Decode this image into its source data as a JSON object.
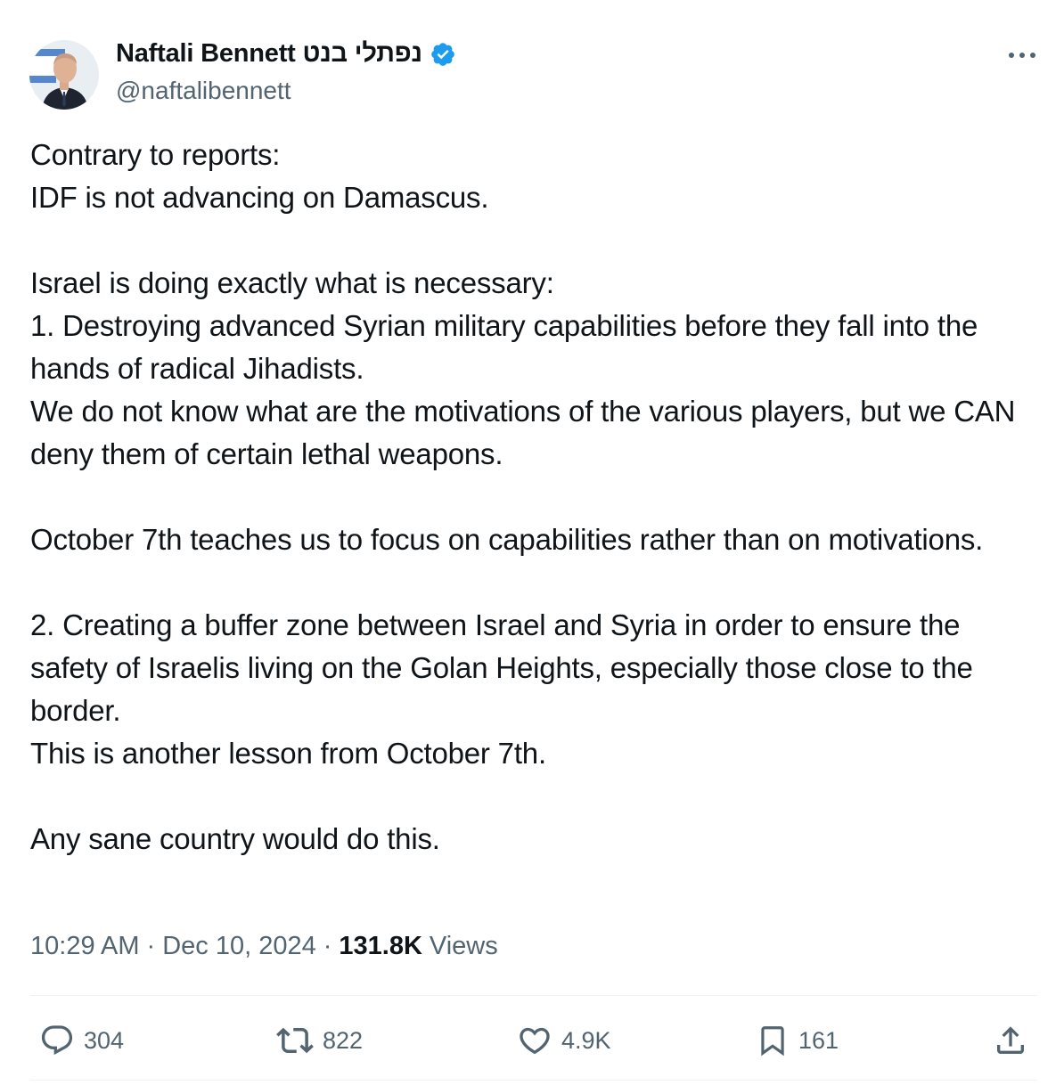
{
  "author": {
    "display_name": "Naftali Bennett נפתלי בנט",
    "handle": "@naftalibennett",
    "verified": true,
    "avatar_icon": "profile-photo-icon"
  },
  "tweet": {
    "paragraphs": [
      [
        "Contrary to reports:",
        "IDF is not advancing on Damascus."
      ],
      [
        "Israel is doing exactly what is necessary:",
        "1. Destroying advanced Syrian military capabilities before they fall into the hands of radical Jihadists.",
        "We do not know what are the motivations of the various players, but we CAN deny them of certain lethal weapons."
      ],
      [
        "October 7th teaches us to focus on capabilities rather than on motivations."
      ],
      [
        "2. Creating a buffer zone between Israel and Syria in order to ensure the safety of Israelis living on the Golan Heights, especially those close to the border.",
        "This is another lesson from October 7th."
      ],
      [
        "Any sane country would do this."
      ]
    ]
  },
  "meta": {
    "time": "10:29 AM",
    "separator": "·",
    "date": "Dec 10, 2024",
    "views_count": "131.8K",
    "views_label": "Views"
  },
  "actions": {
    "replies": "304",
    "reposts": "822",
    "likes": "4.9K",
    "bookmarks": "161"
  },
  "colors": {
    "text_primary": "#0f1419",
    "text_secondary": "#536471",
    "verified_blue": "#1d9bf0",
    "divider": "#eff3f4"
  }
}
